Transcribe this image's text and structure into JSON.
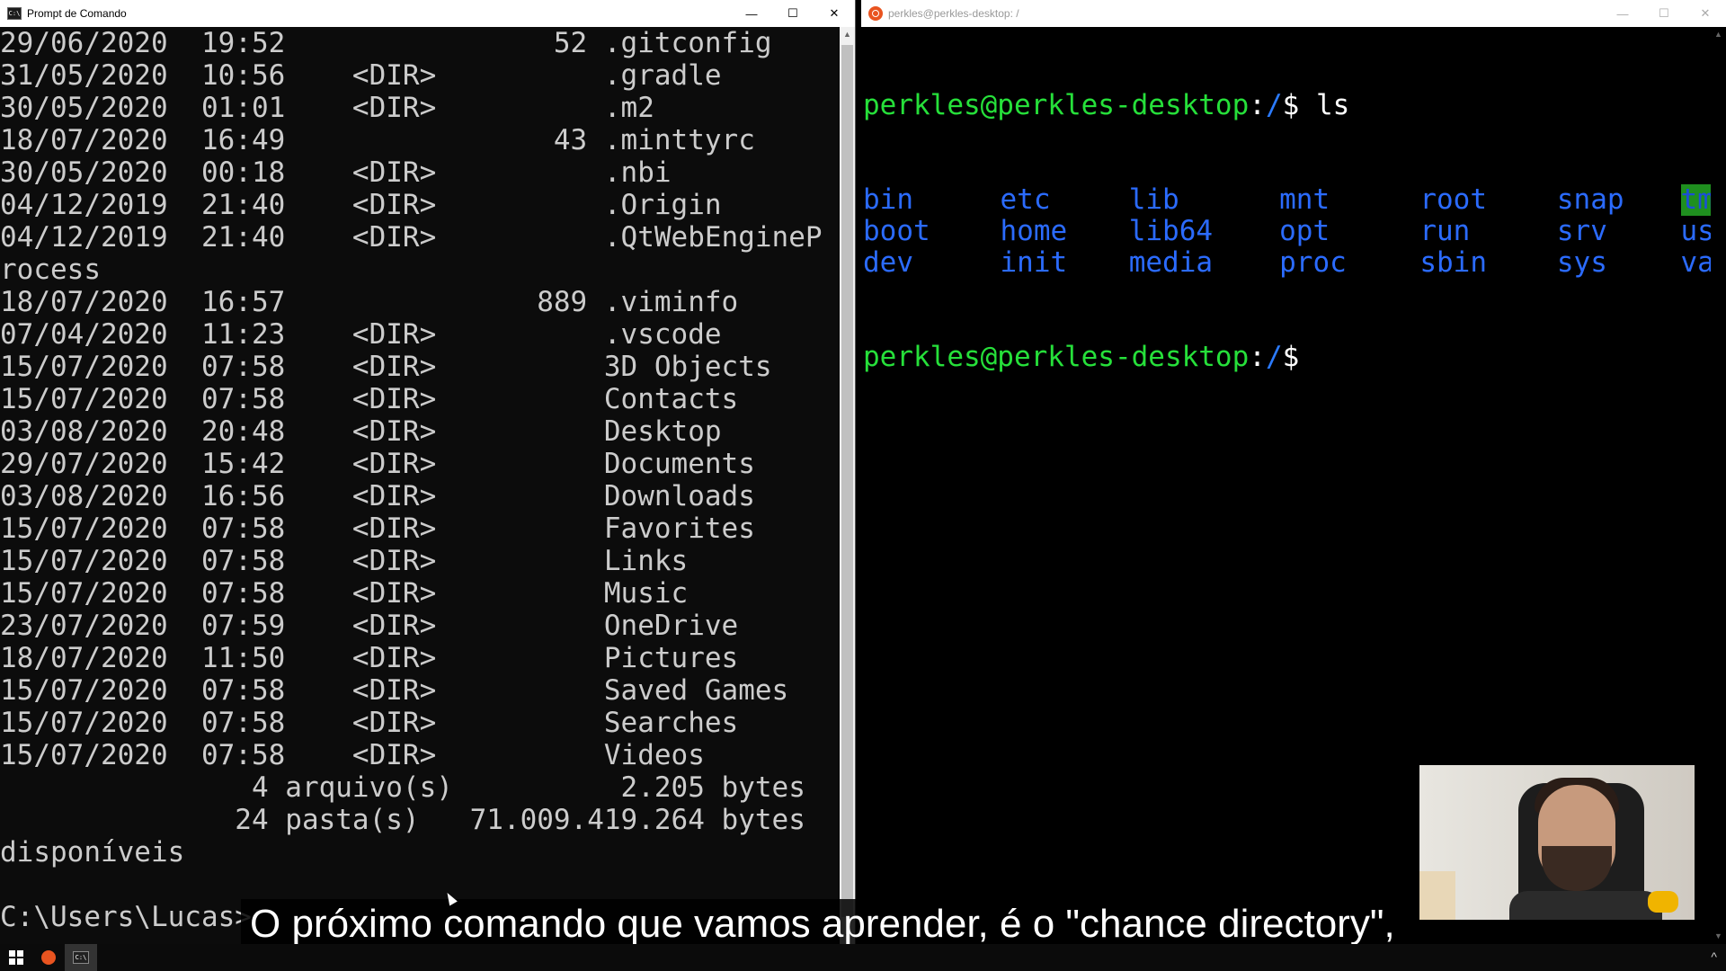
{
  "cmd_window": {
    "title": "Prompt de Comando",
    "controls": {
      "minimize": "—",
      "maximize": "☐",
      "close": "✕"
    },
    "lines": [
      "29/06/2020  19:52                52 .gitconfig",
      "31/05/2020  10:56    <DIR>          .gradle",
      "30/05/2020  01:01    <DIR>          .m2",
      "18/07/2020  16:49                43 .minttyrc",
      "30/05/2020  00:18    <DIR>          .nbi",
      "04/12/2019  21:40    <DIR>          .Origin",
      "04/12/2019  21:40    <DIR>          .QtWebEngineP",
      "rocess",
      "18/07/2020  16:57               889 .viminfo",
      "07/04/2020  11:23    <DIR>          .vscode",
      "15/07/2020  07:58    <DIR>          3D Objects",
      "15/07/2020  07:58    <DIR>          Contacts",
      "03/08/2020  20:48    <DIR>          Desktop",
      "29/07/2020  15:42    <DIR>          Documents",
      "03/08/2020  16:56    <DIR>          Downloads",
      "15/07/2020  07:58    <DIR>          Favorites",
      "15/07/2020  07:58    <DIR>          Links",
      "15/07/2020  07:58    <DIR>          Music",
      "23/07/2020  07:59    <DIR>          OneDrive",
      "18/07/2020  11:50    <DIR>          Pictures",
      "15/07/2020  07:58    <DIR>          Saved Games",
      "15/07/2020  07:58    <DIR>          Searches",
      "15/07/2020  07:58    <DIR>          Videos",
      "               4 arquivo(s)          2.205 bytes",
      "              24 pasta(s)   71.009.419.264 bytes",
      "disponíveis",
      "",
      "C:\\Users\\Lucas>"
    ]
  },
  "ubuntu_window": {
    "title": "perkles@perkles-desktop: /",
    "controls": {
      "minimize": "—",
      "maximize": "☐",
      "close": "✕"
    },
    "prompt_user": "perkles@perkles-desktop",
    "prompt_colon": ":",
    "prompt_path": "/",
    "prompt_dollar": "$ ",
    "command": "ls",
    "ls_rows": [
      [
        "bin",
        "etc",
        "lib",
        "mnt",
        "root",
        "snap",
        "tmp"
      ],
      [
        "boot",
        "home",
        "lib64",
        "opt",
        "run",
        "srv",
        "usr"
      ],
      [
        "dev",
        "init",
        "media",
        "proc",
        "sbin",
        "sys",
        "var"
      ]
    ],
    "highlighted_entry": "tmp"
  },
  "caption": {
    "text": "O próximo comando que vamos aprender, é o \"chance directory\","
  },
  "taskbar": {
    "start_icon": "windows-start-icon",
    "pinned": [
      "ubuntu-icon",
      "cmd-icon"
    ],
    "tray_chevron": "^"
  },
  "colors": {
    "prompt_user": "#26e03a",
    "prompt_path": "#2b7bff",
    "ls_dir": "#2b6bff",
    "tmp_highlight": "#1f8f1f",
    "cmd_text": "#cccccc"
  }
}
